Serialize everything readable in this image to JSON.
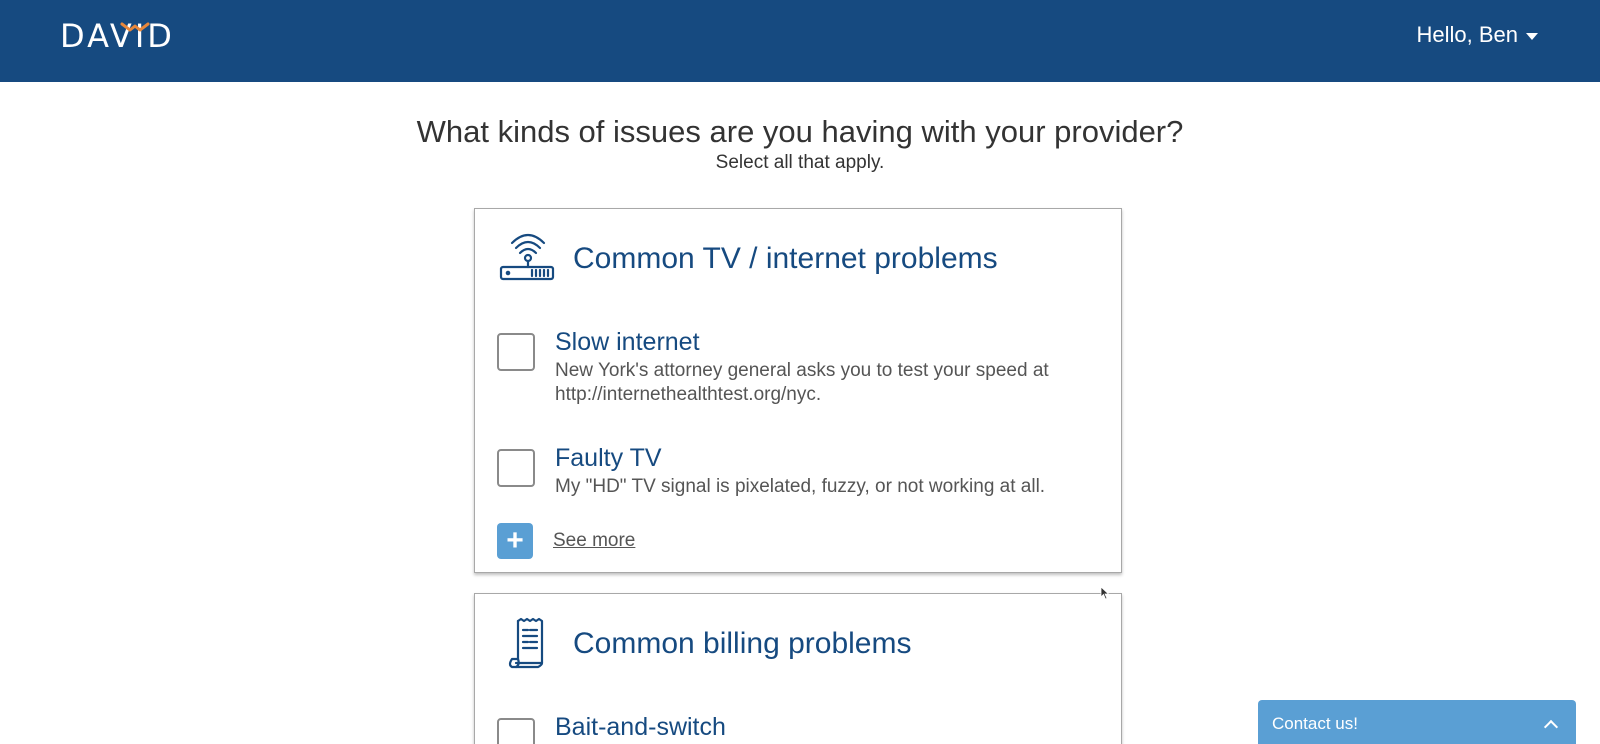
{
  "header": {
    "logo_text": "DAVID",
    "brand_color": "#164a80",
    "logo_accent_color": "#e8873a",
    "user_greeting": "Hello, Ben"
  },
  "page": {
    "heading": "What kinds of issues are you having with your provider?",
    "subheading": "Select all that apply."
  },
  "sections": [
    {
      "icon": "router-icon",
      "title": "Common TV / internet problems",
      "issues": [
        {
          "title": "Slow internet",
          "description": "New York's attorney general asks you to test your speed at http://internethealthtest.org/nyc.",
          "checked": false
        },
        {
          "title": "Faulty TV",
          "description": "My \"HD\" TV signal is pixelated, fuzzy, or not working at all.",
          "checked": false
        }
      ],
      "see_more_label": "See more"
    },
    {
      "icon": "receipt-icon",
      "title": "Common billing problems",
      "issues": [
        {
          "title": "Bait-and-switch",
          "checked": false
        }
      ]
    }
  ],
  "contact": {
    "label": "Contact us!",
    "color": "#5a9fd4"
  }
}
